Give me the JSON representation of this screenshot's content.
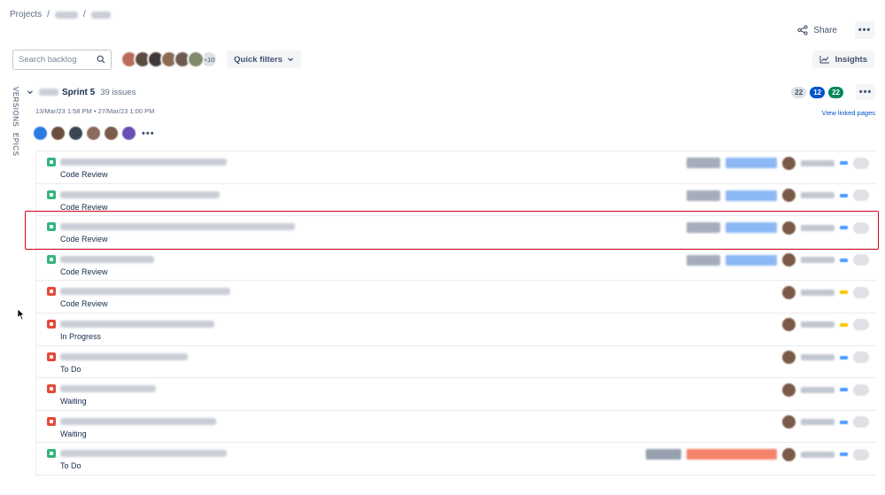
{
  "breadcrumb": {
    "root": "Projects",
    "sep1": "/",
    "sep2": "/"
  },
  "header": {
    "share_label": "Share"
  },
  "toolbar": {
    "search_placeholder": "Search backlog",
    "avatar_overflow": "+10",
    "quick_filters_label": "Quick filters",
    "insights_label": "Insights"
  },
  "side_tabs": {
    "versions": "VERSIONS",
    "epics": "EPICS"
  },
  "sprint": {
    "name": "Sprint 5",
    "issue_count": "39 issues",
    "dates": "13/Mar/23 1:58 PM • 27/Mar/23 1:00 PM",
    "counts": {
      "todo": "22",
      "in_progress": "12",
      "done": "22"
    },
    "linked_pages_label": "View linked pages"
  },
  "colors": {
    "accent_blue": "#0052cc",
    "done_green": "#00875a",
    "story_green": "#36b37e",
    "bug_red": "#e5493a",
    "highlight_red": "#d0021b"
  },
  "issues": [
    {
      "type": "story",
      "status": "Code Review"
    },
    {
      "type": "story",
      "status": "Code Review"
    },
    {
      "type": "story",
      "status": "Code Review"
    },
    {
      "type": "story",
      "status": "Code Review"
    },
    {
      "type": "bug",
      "status": "Code Review"
    },
    {
      "type": "bug",
      "status": "In Progress"
    },
    {
      "type": "bug",
      "status": "To Do"
    },
    {
      "type": "bug",
      "status": "Waiting"
    },
    {
      "type": "bug",
      "status": "Waiting"
    },
    {
      "type": "story",
      "status": "To Do"
    }
  ]
}
